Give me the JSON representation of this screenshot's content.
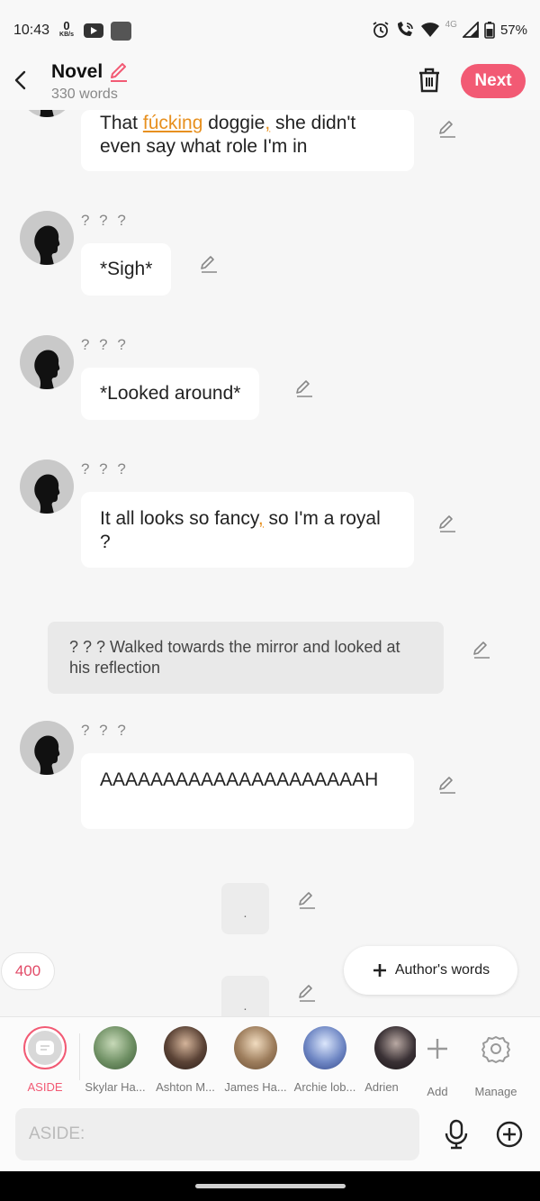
{
  "status_bar": {
    "time": "10:43",
    "net_speed": "0",
    "net_unit": "KB/s",
    "signal_label": "4G",
    "battery": "57%"
  },
  "header": {
    "title": "Novel",
    "word_count": "330 words",
    "next_label": "Next"
  },
  "messages": [
    {
      "type": "dialogue",
      "name": "",
      "text_parts": [
        "That ",
        "fúcking",
        " doggie",
        ",",
        " she didn't even say what role I'm in"
      ]
    },
    {
      "type": "dialogue",
      "name": "? ? ?",
      "text": "*Sigh*"
    },
    {
      "type": "dialogue",
      "name": "? ? ?",
      "text": "*Looked around*"
    },
    {
      "type": "dialogue",
      "name": "? ? ?",
      "text_parts": [
        "It all looks so fancy",
        ",",
        " so I'm a royal ?"
      ]
    },
    {
      "type": "narration",
      "text": "? ? ? Walked towards the mirror and looked at his reflection"
    },
    {
      "type": "dialogue",
      "name": "? ? ?",
      "text": "AAAAAAAAAAAAAAAAAAAAAH"
    },
    {
      "type": "aside",
      "text": "."
    },
    {
      "type": "aside",
      "text": "."
    }
  ],
  "counter": "400",
  "authors_words_label": "Author's words",
  "characters": [
    {
      "label": "ASIDE",
      "active": true,
      "color": "#d8d8d8"
    },
    {
      "label": "Skylar Ha...",
      "color": "#6e8f63"
    },
    {
      "label": "Ashton M...",
      "color": "#5b4336"
    },
    {
      "label": "James Ha...",
      "color": "#9d7d5c"
    },
    {
      "label": "Archie lob...",
      "color": "#6f87c4"
    },
    {
      "label": "Adrien",
      "color": "#3a3135"
    }
  ],
  "add_label": "Add",
  "manage_label": "Manage",
  "input": {
    "placeholder": "ASIDE:"
  },
  "colors": {
    "accent": "#f25a74",
    "highlight": "#e7901f"
  }
}
